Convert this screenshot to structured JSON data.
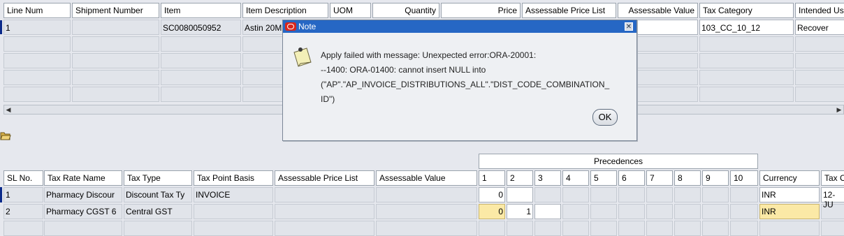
{
  "top_table": {
    "headers": [
      "Line Num",
      "Shipment Number",
      "Item",
      "Item Description",
      "UOM",
      "Quantity",
      "Price",
      "Assessable Price List",
      "Assessable Value",
      "Tax Category",
      "Intended Us"
    ],
    "row1": {
      "line_num": "1",
      "item": "SC0080050952",
      "item_description": "Astin 20M",
      "tax_category": "103_CC_10_12",
      "intended_use": "Recover"
    }
  },
  "toolbar": {
    "folder_icon": "open-folder-icon"
  },
  "precedences_label": "Precedences",
  "bottom_table": {
    "headers": [
      "SL No.",
      "Tax Rate Name",
      "Tax Type",
      "Tax Point Basis",
      "Assessable Price List",
      "Assessable Value",
      "1",
      "2",
      "3",
      "4",
      "5",
      "6",
      "7",
      "8",
      "9",
      "10",
      "Currency",
      "Tax C"
    ],
    "rows": [
      {
        "sl": "1",
        "tax_rate_name": "Pharmacy Discour",
        "tax_type": "Discount Tax Ty",
        "tax_point_basis": "INVOICE",
        "p1": "0",
        "p2": "",
        "currency": "INR",
        "date": "12-JU"
      },
      {
        "sl": "2",
        "tax_rate_name": "Pharmacy CGST 6",
        "tax_type": "Central GST",
        "tax_point_basis": "",
        "p1": "0",
        "p2": "1",
        "currency": "INR",
        "date": ""
      }
    ]
  },
  "dialog": {
    "title": "Note",
    "message_lines": [
      "Apply failed with message: Unexpected error:ORA-20001:",
      "--1400: ORA-01400: cannot insert NULL into",
      "(\"AP\".\"AP_INVOICE_DISTRIBUTIONS_ALL\".\"DIST_CODE_COMBINATION_",
      "ID\")"
    ],
    "ok_label": "OK",
    "colors": {
      "title_bar": "#2667c4",
      "oracle_logo": "#d8261c"
    }
  }
}
